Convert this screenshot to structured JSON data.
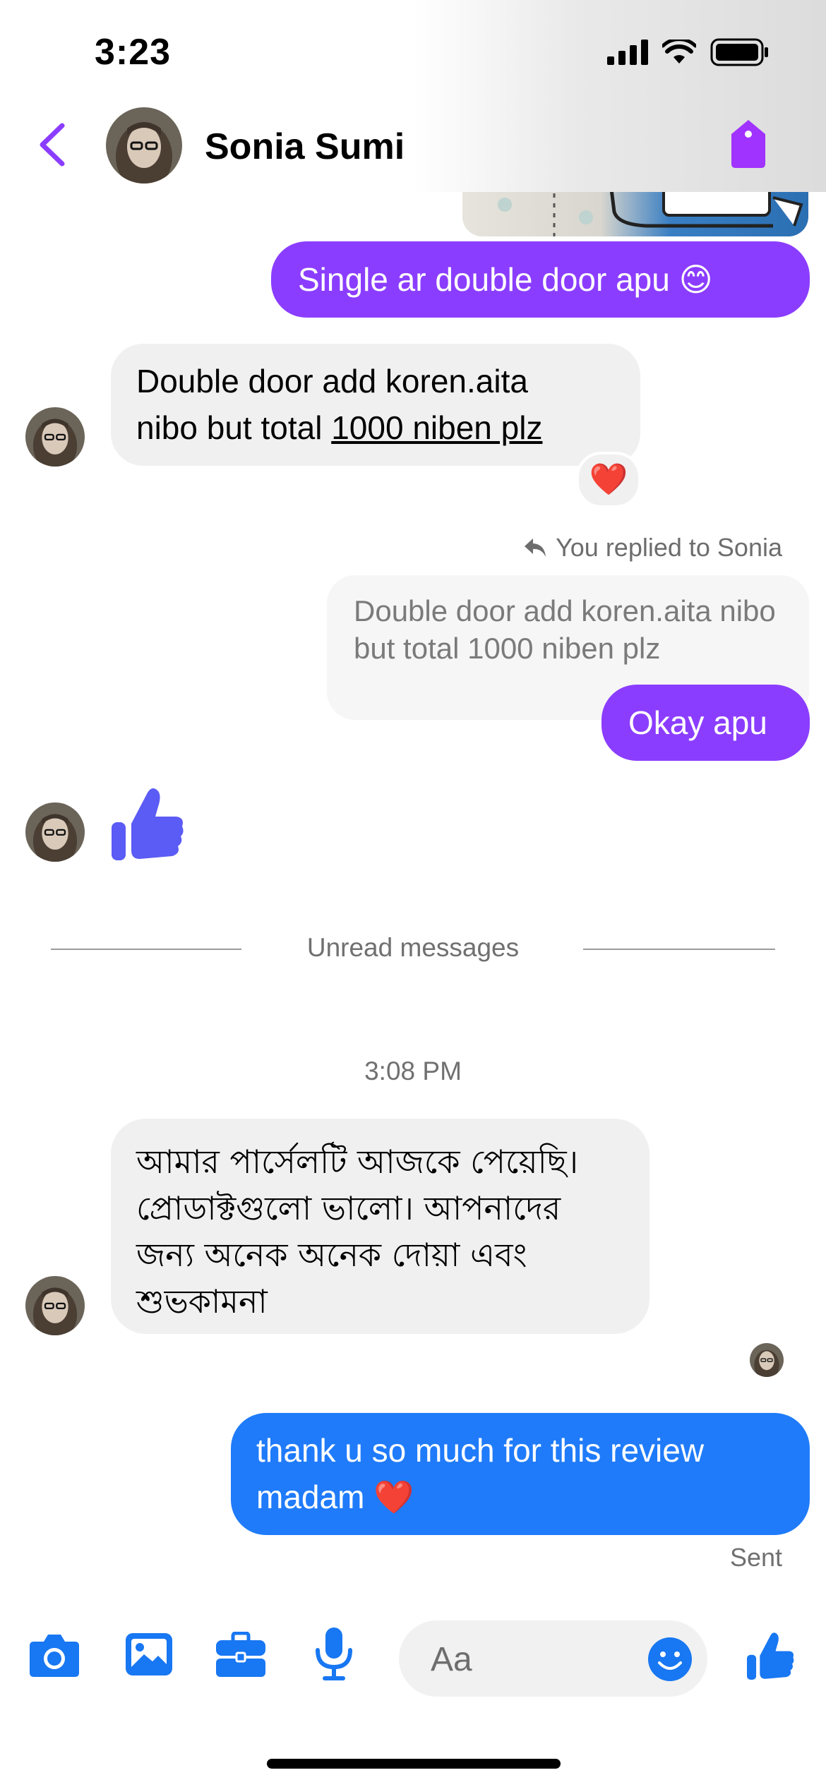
{
  "status_bar": {
    "time": "3:23"
  },
  "header": {
    "contact_name": "Sonia Sumi"
  },
  "messages": {
    "m1_text": "Single ar double door apu 😊",
    "m2_line1": "Double door add koren.aita",
    "m2_line2_plain": "nibo but total ",
    "m2_line2_link": "1000 niben plz",
    "m2_reaction": "❤️",
    "reply_label": "You replied to Sonia",
    "quoted_text": "Double door add koren.aita nibo but total 1000 niben plz",
    "m3_text": "Okay apu",
    "divider_text": "Unread messages",
    "timestamp": "3:08 PM",
    "m4_text": "আমার পার্সেলটি আজকে পেয়েছি। প্রোডাক্টগুলো ভালো। আপনাদের জন্য অনেক অনেক দোয়া এবং শুভকামনা",
    "m5_text": "thank u so much for this review madam ❤️",
    "sent_label": "Sent"
  },
  "composer": {
    "placeholder": "Aa"
  },
  "colors": {
    "accent_purple": "#8b3dff",
    "sent_blue": "#1f7bfa",
    "icon_blue": "#1877f2",
    "like_purple": "#5b5bf5",
    "received_grey": "#f0f0f0"
  }
}
